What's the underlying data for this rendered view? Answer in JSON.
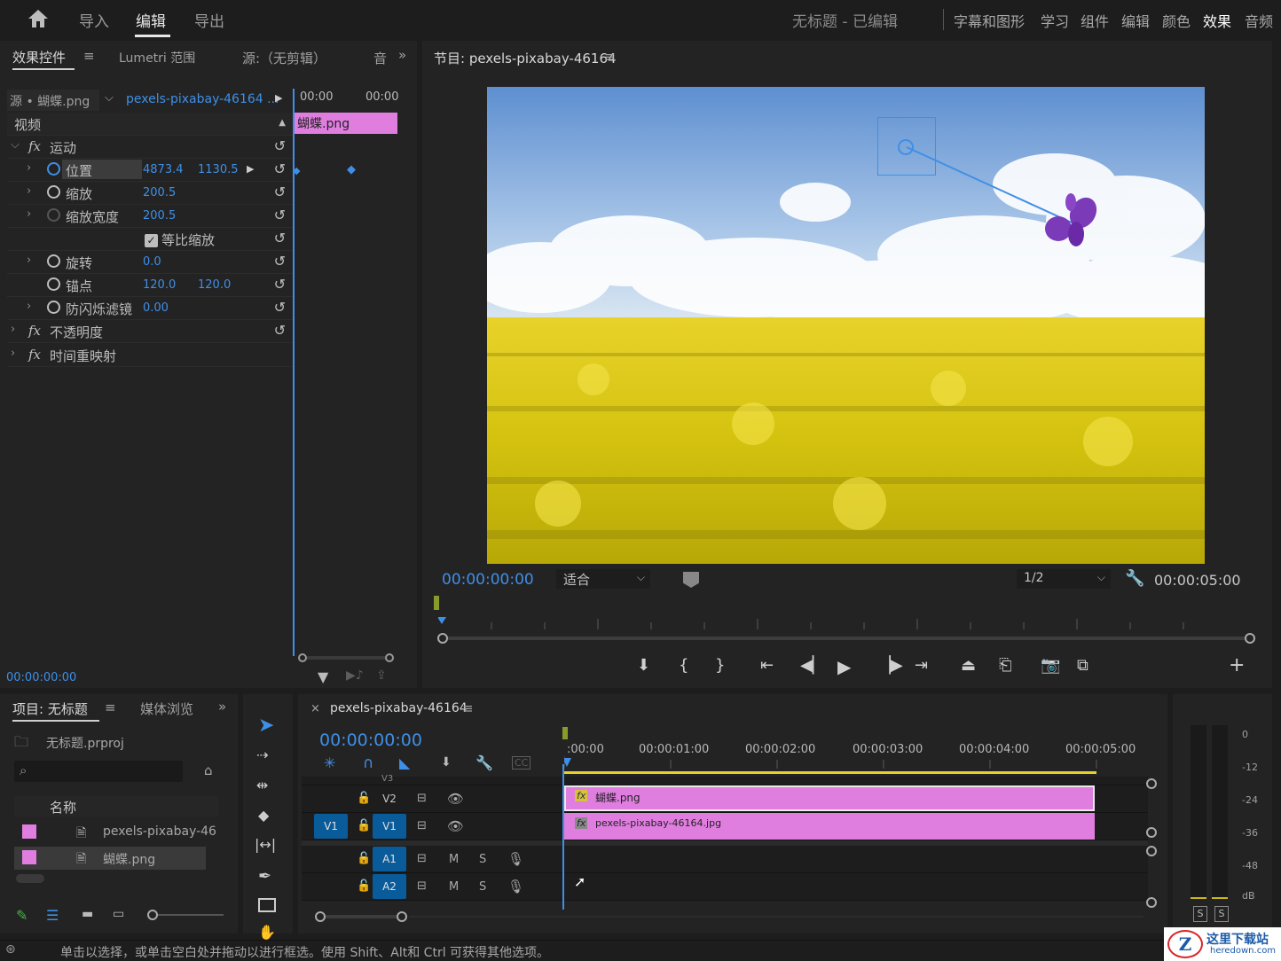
{
  "topbar": {
    "home_label": "⌂",
    "tabs": [
      "导入",
      "编辑",
      "导出"
    ],
    "active_tab": "编辑",
    "project_title": "无标题 - 已编辑",
    "workspaces": [
      "字幕和图形",
      "学习",
      "组件",
      "编辑",
      "颜色",
      "效果",
      "音频"
    ],
    "active_workspace": "效果"
  },
  "effect_controls": {
    "tabs": [
      "效果控件",
      "Lumetri 范围",
      "源:（无剪辑）",
      "音"
    ],
    "source_label": "源 • 蝴蝶.png",
    "sequence_label": "pexels-pixabay-46164 ...",
    "ruler_start": "00:00",
    "ruler_end": "00:00",
    "clip_label": "蝴蝶.png",
    "section_video": "视频",
    "fx_motion": "运动",
    "position_label": "位置",
    "position_x": "4873.4",
    "position_y": "1130.5",
    "scale_label": "缩放",
    "scale_value": "200.5",
    "scale_width_label": "缩放宽度",
    "scale_width_value": "200.5",
    "uniform_scale_label": "等比缩放",
    "rotation_label": "旋转",
    "rotation_value": "0.0",
    "anchor_label": "锚点",
    "anchor_x": "120.0",
    "anchor_y": "120.0",
    "antiflicker_label": "防闪烁滤镜",
    "antiflicker_value": "0.00",
    "fx_opacity": "不透明度",
    "fx_time_remap": "时间重映射",
    "timecode": "00:00:00:00"
  },
  "program_monitor": {
    "title": "节目: pexels-pixabay-46164",
    "timecode": "00:00:00:00",
    "fit_label": "适合",
    "resolution": "1/2",
    "duration": "00:00:05:00"
  },
  "project_panel": {
    "tabs": [
      "项目: 无标题",
      "媒体浏览"
    ],
    "project_file": "无标题.prproj",
    "column_name": "名称",
    "items": [
      {
        "name": "pexels-pixabay-46",
        "color": "#e07ee0"
      },
      {
        "name": "蝴蝶.png",
        "color": "#e07ee0"
      }
    ]
  },
  "timeline": {
    "sequence_tab": "pexels-pixabay-46164",
    "timecode": "00:00:00:00",
    "ruler": [
      ":00:00",
      "00:00:01:00",
      "00:00:02:00",
      "00:00:03:00",
      "00:00:04:00",
      "00:00:05:00"
    ],
    "tracks": {
      "v3": "V3",
      "v2": "V2",
      "v1_src": "V1",
      "v1": "V1",
      "a1": "A1",
      "a2": "A2",
      "mute": "M",
      "solo": "S"
    },
    "clips": [
      {
        "name": "蝴蝶.png",
        "track": "V2"
      },
      {
        "name": "pexels-pixabay-46164.jpg",
        "track": "V1"
      }
    ]
  },
  "audio_meter": {
    "labels": [
      "0",
      "-12",
      "-24",
      "-36",
      "-48",
      "dB"
    ],
    "solo_left": "S",
    "solo_right": "S"
  },
  "status_bar": {
    "text": "单击以选择，或单击空白处并拖动以进行框选。使用 Shift、Alt和 Ctrl 可获得其他选项。"
  },
  "watermark": {
    "text": "这里下载站",
    "url": "heredown.com"
  }
}
